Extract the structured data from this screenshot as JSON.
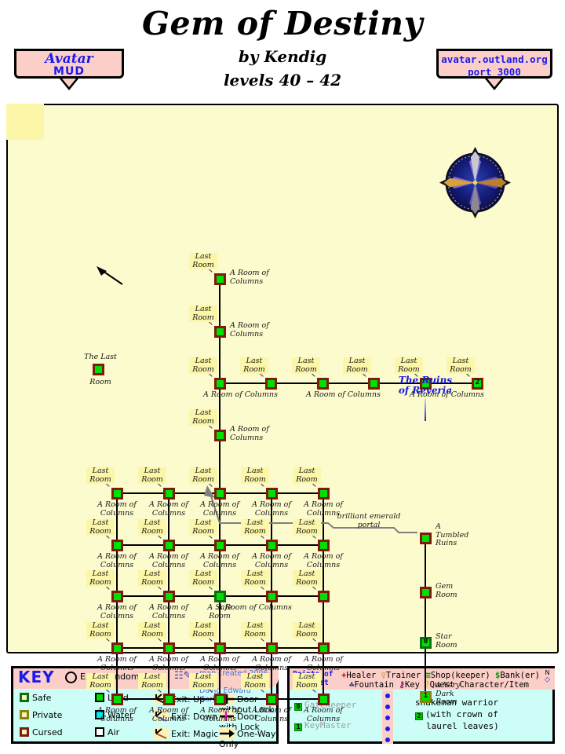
{
  "header": {
    "title": "Gem of Destiny",
    "author": "by Kendig",
    "levels": "levels 40 – 42",
    "banner_left_line1": "Avatar",
    "banner_left_line2": "MUD",
    "banner_right_line1": "avatar.outland.org",
    "banner_right_line2": "port 3000"
  },
  "map": {
    "region_title": "The Ruins\nof Reveria",
    "region_title_line1": "The Ruins",
    "region_title_line2": "of Reveria",
    "portal_label_line1": "brilliant emerald",
    "portal_label_line2": "portal",
    "room_name_columns_l1": "A Room of",
    "room_name_columns_l2": "Columns",
    "room_name_columns_single": "A Room of Columns",
    "exit_label_l1": "Last",
    "exit_label_l2": "Room",
    "isolated_room_l1": "The Last",
    "isolated_room_l2": "Room",
    "safe_room_l1": "A Safe",
    "safe_room_l2": "Room",
    "tumbled_l1": "A",
    "tumbled_l2": "Tumbled",
    "tumbled_l3": "Ruins",
    "gem_l1": "Gem",
    "gem_l2": "Room",
    "star_l1": "Star",
    "star_l2": "Room",
    "dark_l1": "A Very",
    "dark_l2": "Dark",
    "dark_l3": "Room",
    "marker_star": "0",
    "marker_dark": "1",
    "marker_snake": "2",
    "colors": {
      "parchment": "#fcfbcd",
      "room_fill": "#00e000",
      "border_land": "#7d1b10",
      "border_safe": "#0b7010",
      "border_private": "#8a8213",
      "region_title": "#1818dd",
      "portal_line": "#808080"
    }
  },
  "key": {
    "title": "KEY",
    "randomized": "Exits Randomized",
    "credit_line1": "map created 2006 by",
    "credit_line2": "David Edward Garber",
    "col1": [
      {
        "label": "Safe",
        "fill": "#fcf2b8",
        "border": "#0b7010"
      },
      {
        "label": "Private",
        "fill": "#fcf2b8",
        "border": "#8a8213"
      },
      {
        "label": "Cursed",
        "fill": "#fcf2b8",
        "border": "#7d1b10"
      }
    ],
    "col2": [
      {
        "label": "Land",
        "fill": "#00e000",
        "border": "#000000"
      },
      {
        "label": "Water",
        "fill": "#00e8f0",
        "border": "#000000"
      },
      {
        "label": "Air",
        "fill": "#ffffff",
        "border": "#000000"
      }
    ],
    "col3": [
      {
        "label": "Exit: Up",
        "icon": "exit-up-icon"
      },
      {
        "label": "Exit: Down",
        "icon": "exit-down-icon"
      },
      {
        "label": "Exit: Magical",
        "icon": "exit-magical-icon"
      }
    ],
    "col4": [
      {
        "label": "Door without Lock",
        "icon": "door-plain-icon"
      },
      {
        "label": "Door with Lock",
        "icon": "door-locked-icon"
      },
      {
        "label": "One-Way Only",
        "icon": "one-way-arrow-icon"
      }
    ]
  },
  "poi": {
    "title_line1": "Points of",
    "title_line2": "Interest",
    "legend_row1": "+Healer  ♀Trainer  ≡Shop(keeper)  $Bank(er)",
    "legend_row2": "☘Fountain  ⚷Key  ?Quest Character/Item",
    "legend_items_row1": [
      {
        "glyph": "+",
        "label": "Healer",
        "color": "#cc0000"
      },
      {
        "glyph": "♀",
        "label": "Trainer",
        "color": "#e09000"
      },
      {
        "glyph": "≡",
        "label": "Shop(keeper)",
        "color": "#00a000"
      },
      {
        "glyph": "$",
        "label": "Bank(er)",
        "color": "#00a000"
      }
    ],
    "legend_items_row2": [
      {
        "glyph": "☘",
        "label": "Fountain",
        "color": "#203080"
      },
      {
        "glyph": "⚷",
        "label": "Key",
        "color": "#7a2060"
      },
      {
        "glyph": "?",
        "label": "Quest Character/Item",
        "color": "#e0c000"
      }
    ],
    "compass_n": "N",
    "compass_glyph": "⬦",
    "entries": [
      {
        "marker": "0",
        "name": "GateKeeper"
      },
      {
        "marker": "1",
        "name": "KeyMaster"
      }
    ],
    "note_marker": "2",
    "note_line1": "snakeman warrior",
    "note_line2": "(with crown of",
    "note_line3": "laurel leaves)"
  }
}
